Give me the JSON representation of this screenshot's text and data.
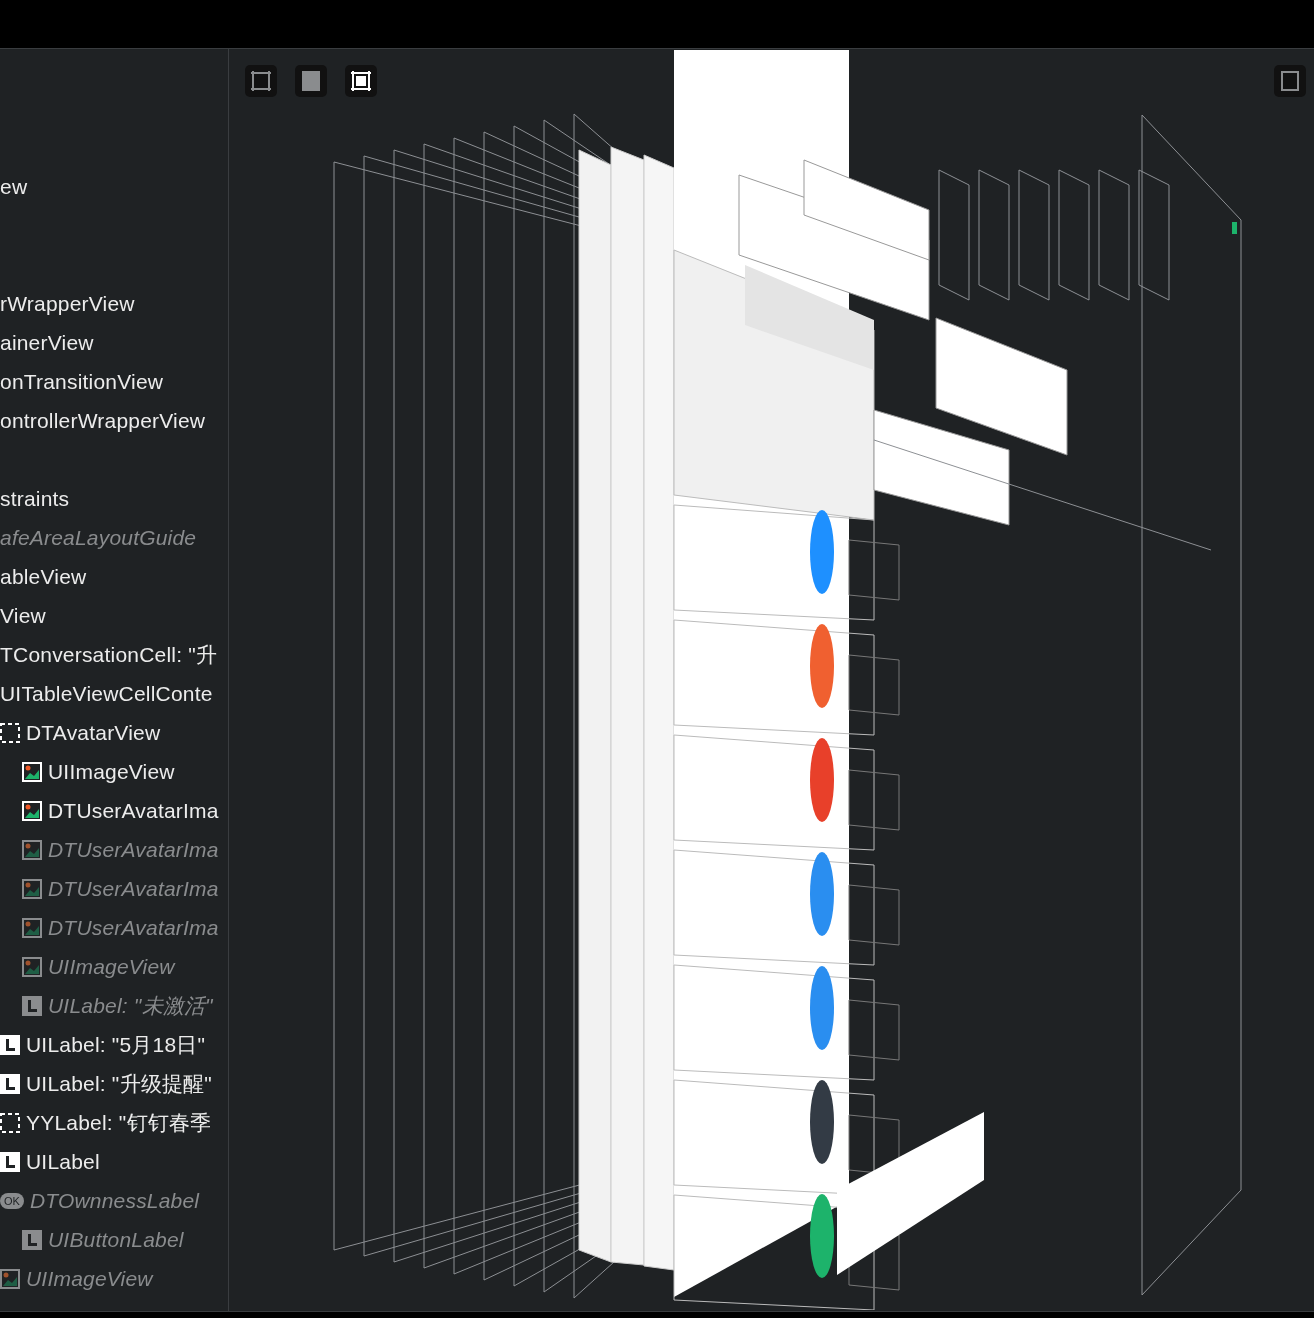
{
  "navigator": {
    "items": [
      {
        "text": "ew",
        "kind": "plain",
        "hidden": false
      },
      {
        "kind": "blank"
      },
      {
        "kind": "blank"
      },
      {
        "text": "rWrapperView",
        "kind": "plain",
        "hidden": false
      },
      {
        "text": "ainerView",
        "kind": "plain",
        "hidden": false
      },
      {
        "text": "onTransitionView",
        "kind": "plain",
        "hidden": false
      },
      {
        "text": "ontrollerWrapperView",
        "kind": "plain",
        "hidden": false
      },
      {
        "kind": "blank"
      },
      {
        "text": "straints",
        "kind": "plain",
        "hidden": false
      },
      {
        "text": "afeAreaLayoutGuide",
        "kind": "plain",
        "hidden": true
      },
      {
        "text": "ableView",
        "kind": "plain",
        "hidden": false
      },
      {
        "text": "View",
        "kind": "plain",
        "hidden": false
      },
      {
        "text": "TConversationCell: \"升",
        "kind": "plain",
        "hidden": false
      },
      {
        "text": "UITableViewCellConte",
        "kind": "plain",
        "hidden": false
      },
      {
        "text": "DTAvatarView",
        "kind": "dashed",
        "hidden": false,
        "children": [
          {
            "text": "UIImageView",
            "kind": "image",
            "hidden": false
          },
          {
            "text": "DTUserAvatarIma",
            "kind": "image",
            "hidden": false
          },
          {
            "text": "DTUserAvatarIma",
            "kind": "image",
            "hidden": true
          },
          {
            "text": "DTUserAvatarIma",
            "kind": "image",
            "hidden": true
          },
          {
            "text": "DTUserAvatarIma",
            "kind": "image",
            "hidden": true
          },
          {
            "text": "UIImageView",
            "kind": "image",
            "hidden": true
          },
          {
            "text": "UILabel: \"未激活\"",
            "kind": "label",
            "hidden": true
          }
        ]
      },
      {
        "text": "UILabel: \"5月18日\"",
        "kind": "label",
        "hidden": false
      },
      {
        "text": "UILabel: \"升级提醒\"",
        "kind": "label",
        "hidden": false
      },
      {
        "text": "YYLabel: \"钉钉春季",
        "kind": "dashed",
        "hidden": false
      },
      {
        "text": "UILabel",
        "kind": "label",
        "hidden": false
      },
      {
        "text": "DTOwnnessLabel",
        "kind": "ok",
        "badge": "OK",
        "hidden": true,
        "children": [
          {
            "text": "UIButtonLabel",
            "kind": "label",
            "hidden": true
          }
        ]
      },
      {
        "text": "UIImageView",
        "kind": "image",
        "hidden": true
      }
    ]
  },
  "canvas": {
    "toolbar": [
      {
        "kind": "wireframe",
        "selected": false
      },
      {
        "kind": "contents",
        "selected": false
      },
      {
        "kind": "both",
        "selected": true
      }
    ],
    "right_tool": {
      "kind": "frame",
      "selected": false
    }
  }
}
